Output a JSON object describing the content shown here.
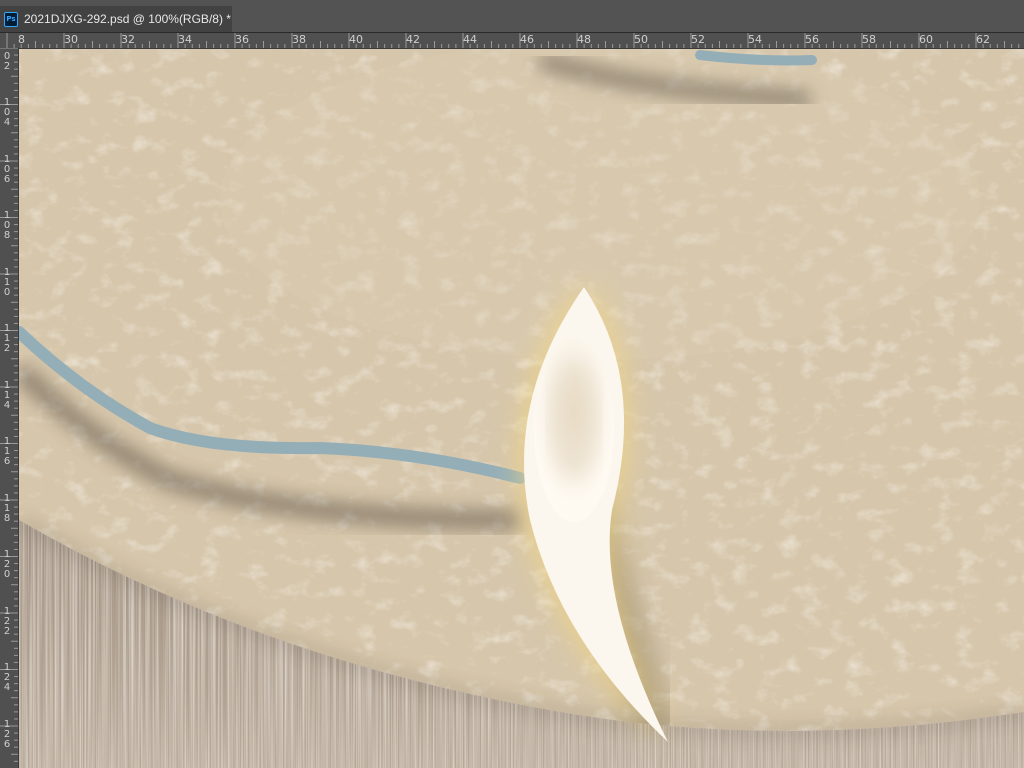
{
  "document": {
    "app_icon": "photoshop-app-icon",
    "app_icon_text": "Ps",
    "tab_title": "2021DJXG-292.psd @ 100%(RGB/8) *"
  },
  "ruler_top": {
    "labels": [
      "8",
      "30",
      "32",
      "34",
      "36",
      "38",
      "40",
      "42",
      "44",
      "46",
      "48",
      "50",
      "52",
      "54",
      "56",
      "58",
      "60",
      "62"
    ]
  },
  "ruler_left": {
    "labels": [
      "0\n2",
      "1\n0\n4",
      "1\n0\n6",
      "1\n0\n8",
      "1\n1\n0",
      "1\n1\n2",
      "1\n1\n4",
      "1\n1\n6",
      "1\n1\n8",
      "1\n2\n0",
      "1\n2\n2",
      "1\n2\n4",
      "1\n2\n6"
    ]
  },
  "canvas": {
    "leather_color": "#d8c8ae",
    "wood_color": "#8a7866",
    "river_color": "#94aeb8",
    "glow_color": "#f6d97e",
    "leaf_color": "#fbf6ee"
  }
}
